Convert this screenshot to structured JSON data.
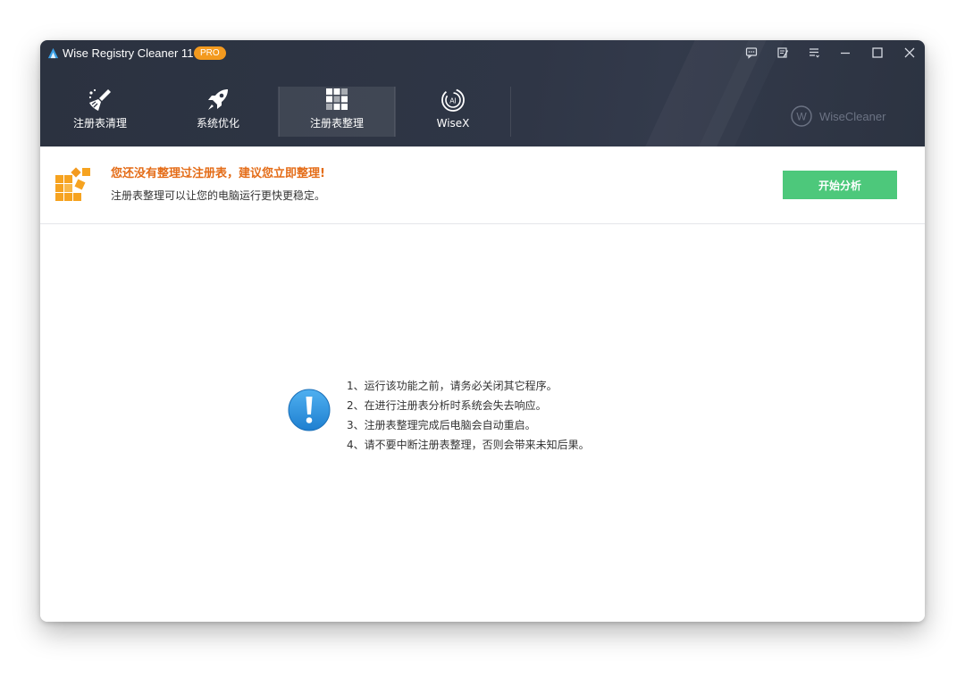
{
  "window": {
    "title": "Wise Registry Cleaner 11",
    "badge": "PRO"
  },
  "titlebar_buttons": [
    {
      "name": "feedback-icon"
    },
    {
      "name": "edit-notes-icon"
    },
    {
      "name": "menu-icon"
    },
    {
      "name": "minimize-icon"
    },
    {
      "name": "maximize-icon"
    },
    {
      "name": "close-icon"
    }
  ],
  "nav": {
    "items": [
      {
        "label": "注册表清理",
        "icon": "broom-icon",
        "active": false
      },
      {
        "label": "系统优化",
        "icon": "rocket-icon",
        "active": false
      },
      {
        "label": "注册表整理",
        "icon": "grid-blocks-icon",
        "active": true
      },
      {
        "label": "WiseX",
        "icon": "ai-swirl-icon",
        "active": false
      }
    ]
  },
  "brand": {
    "name": "WiseCleaner"
  },
  "notice": {
    "title": "您还没有整理过注册表，建议您立即整理!",
    "subtitle": "注册表整理可以让您的电脑运行更快更稳定。",
    "button_label": "开始分析"
  },
  "tips": [
    "1、运行该功能之前，请务必关闭其它程序。",
    "2、在进行注册表分析时系统会失去响应。",
    "3、注册表整理完成后电脑会自动重启。",
    "4、请不要中断注册表整理，否则会带来未知后果。"
  ],
  "colors": {
    "header_bg": "#2f3646",
    "accent_orange": "#e46c17",
    "pro_badge": "#f39a1f",
    "start_button": "#4dc87b",
    "info_blue": "#2b8ddb"
  }
}
